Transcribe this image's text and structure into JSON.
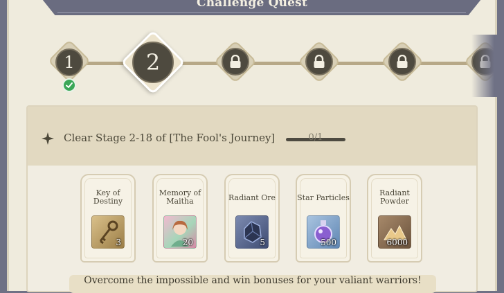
{
  "header": {
    "title": "Challenge Quest"
  },
  "stepper": {
    "steps": [
      {
        "label": "1",
        "state": "completed"
      },
      {
        "label": "2",
        "state": "active"
      },
      {
        "label": "",
        "state": "locked"
      },
      {
        "label": "",
        "state": "locked"
      },
      {
        "label": "",
        "state": "locked"
      },
      {
        "label": "",
        "state": "locked"
      }
    ]
  },
  "quest": {
    "title": "Clear Stage 2-18 of [The Fool's Journey]",
    "progress_text": "0/1",
    "progress_fraction": 0
  },
  "rewards": [
    {
      "name": "Key of Destiny",
      "qty": "3",
      "icon": "key-icon",
      "tile_color": "#b89a5e"
    },
    {
      "name": "Memory of Maitha",
      "qty": "20",
      "icon": "portrait-icon",
      "tile_color": "#d889a6"
    },
    {
      "name": "Radiant Ore",
      "qty": "5",
      "icon": "ore-icon",
      "tile_color": "#5b6f9a"
    },
    {
      "name": "Star Particles",
      "qty": "500",
      "icon": "potion-icon",
      "tile_color": "#7fa4c8"
    },
    {
      "name": "Radiant Powder",
      "qty": "6000",
      "icon": "powder-icon",
      "tile_color": "#8a6f55"
    }
  ],
  "footer": {
    "text": "Overcome the impossible and win bonuses for your valiant warriors!"
  },
  "colors": {
    "accent_dark": "#4e4a3f",
    "complete_green": "#3aa757",
    "panel_bg": "#efebdd"
  }
}
